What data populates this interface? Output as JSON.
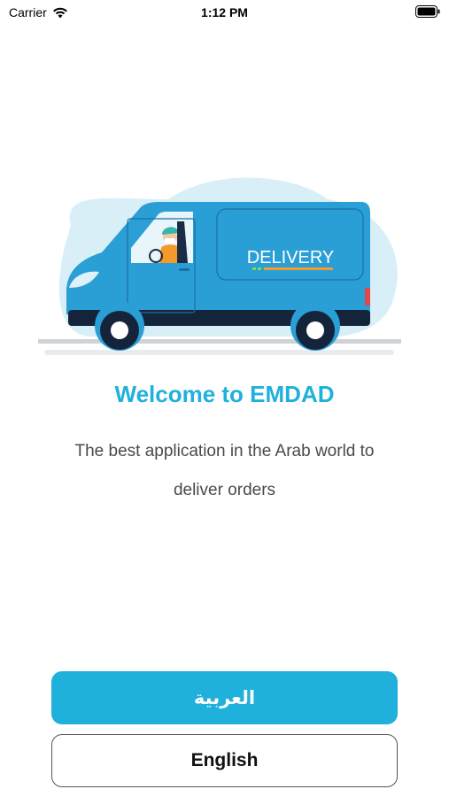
{
  "status_bar": {
    "carrier": "Carrier",
    "time": "1:12 PM"
  },
  "illustration": {
    "van_label": "DELIVERY",
    "icon": "delivery-van-illustration"
  },
  "welcome": {
    "title": "Welcome to EMDAD",
    "subtitle": "The best application in the Arab world to deliver orders"
  },
  "buttons": {
    "arabic_label": "العربية",
    "english_label": "English"
  },
  "colors": {
    "accent": "#1fb0dc",
    "van_body": "#2a9fd6",
    "background_blob": "#d8eff8"
  }
}
